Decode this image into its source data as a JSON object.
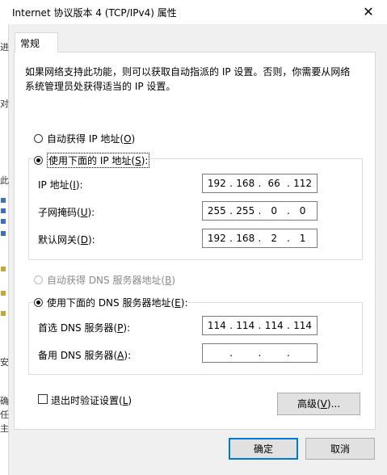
{
  "window": {
    "title": "Internet 协议版本 4 (TCP/IPv4) 属性",
    "close_glyph": "✕"
  },
  "tab": {
    "label": "常规"
  },
  "description": "如果网络支持此功能，则可以获取自动指派的 IP 设置。否则，你需要从网络系统管理员处获得适当的 IP 设置。",
  "ip_mode": {
    "auto_label": "自动获得 IP 地址(",
    "auto_key": "O",
    "manual_label": "使用下面的 IP 地址(",
    "manual_key": "S",
    "selected": "manual"
  },
  "ip_fields": {
    "ip": {
      "label": "IP 地址(",
      "key": "I",
      "octets": [
        "192",
        "168",
        "66",
        "112"
      ]
    },
    "mask": {
      "label": "子网掩码(",
      "key": "U",
      "octets": [
        "255",
        "255",
        "0",
        "0"
      ]
    },
    "gateway": {
      "label": "默认网关(",
      "key": "D",
      "octets": [
        "192",
        "168",
        "2",
        "1"
      ]
    }
  },
  "dns_mode": {
    "auto_label": "自动获得 DNS 服务器地址(",
    "auto_key": "B",
    "manual_label": "使用下面的 DNS 服务器地址(",
    "manual_key": "E",
    "selected": "manual"
  },
  "dns_fields": {
    "preferred": {
      "label": "首选 DNS 服务器(",
      "key": "P",
      "octets": [
        "114",
        "114",
        "114",
        "114"
      ]
    },
    "alternate": {
      "label": "备用 DNS 服务器(",
      "key": "A",
      "octets": [
        "",
        "",
        "",
        ""
      ]
    }
  },
  "validate": {
    "label": "退出时验证设置(",
    "key": "L",
    "checked": false
  },
  "buttons": {
    "advanced": "高级(",
    "advanced_key": "V",
    "advanced_suffix": ")...",
    "ok": "确定",
    "cancel": "取消"
  },
  "close_paren": ")",
  "colon": ":",
  "background_strip": {
    "texts": [
      "进",
      "对",
      "此",
      "安",
      "确",
      "任",
      "主"
    ]
  }
}
